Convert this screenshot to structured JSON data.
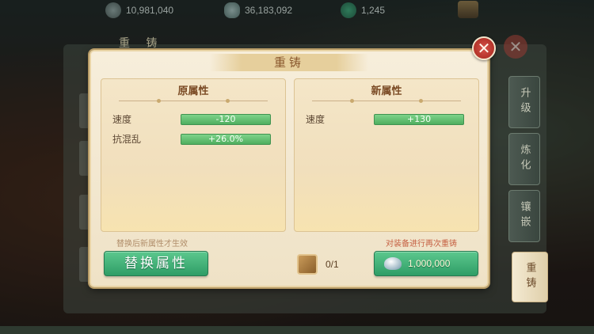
{
  "currencies": [
    {
      "icon": "coin-icon",
      "value": "10,981,040"
    },
    {
      "icon": "silver-icon",
      "value": "36,183,092"
    },
    {
      "icon": "jade-icon",
      "value": "1,245"
    }
  ],
  "back_panel": {
    "title": "重 铸"
  },
  "side_tabs": [
    "升级",
    "炼化",
    "镶嵌",
    "重铸"
  ],
  "dialog": {
    "title": "重铸",
    "close_label": "✕",
    "old": {
      "heading": "原属性",
      "attrs": [
        {
          "name": "速度",
          "value": "-120"
        },
        {
          "name": "抗混乱",
          "value": "+26.0%"
        }
      ]
    },
    "new": {
      "heading": "新属性",
      "attrs": [
        {
          "name": "速度",
          "value": "+130"
        }
      ]
    },
    "hint_left": "替换后新属性才生效",
    "hint_right": "对装备进行再次重铸",
    "replace_label": "替换属性",
    "material_count": "0/1",
    "reforge_cost": "1,000,000"
  },
  "colors": {
    "accent_green": "#2f9d66",
    "title_brown": "#8b5a2f",
    "close_red": "#b33329"
  }
}
